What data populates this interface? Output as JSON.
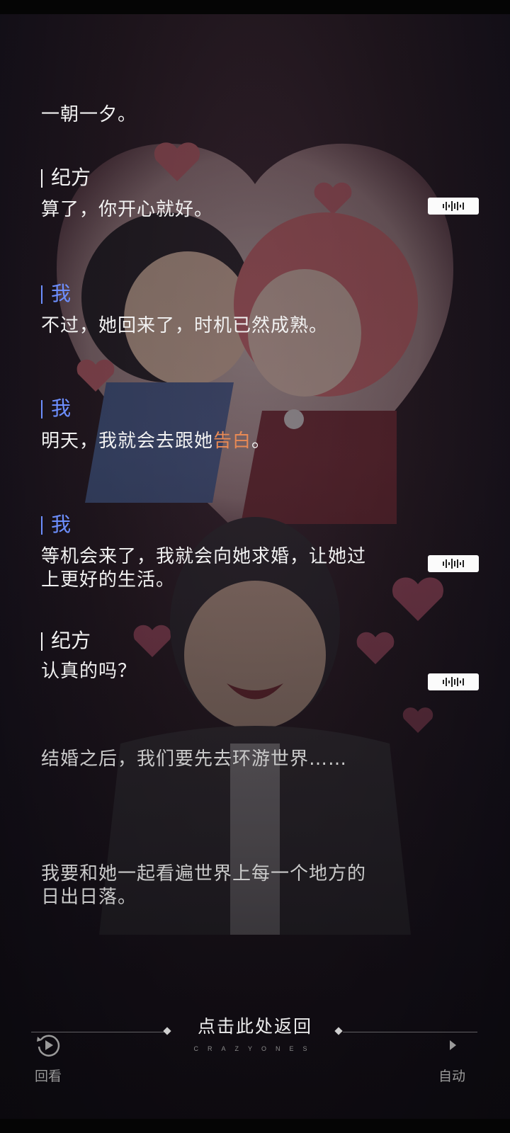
{
  "log": {
    "entries": [
      {
        "type": "line",
        "text": "一朝一夕。"
      },
      {
        "type": "speaker",
        "name": "纪方"
      },
      {
        "type": "line",
        "text": "算了，你开心就好。"
      },
      {
        "type": "speaker",
        "name": "我"
      },
      {
        "type": "line",
        "text": "不过，她回来了，时机已然成熟。"
      },
      {
        "type": "speaker",
        "name": "我"
      },
      {
        "type": "line",
        "text_before": "明天，我就会去跟她",
        "highlight": "告白",
        "text_after": "。"
      },
      {
        "type": "speaker",
        "name": "我"
      },
      {
        "type": "line",
        "text_line1": "等机会来了，我就会向她求婚，让她过",
        "text_line2": "上更好的生活。"
      },
      {
        "type": "speaker",
        "name": "纪方"
      },
      {
        "type": "line",
        "text": "认真的吗？"
      },
      {
        "type": "narration",
        "text": "结婚之后，我们要先去环游世界……"
      },
      {
        "type": "narration",
        "text_line1": "我要和她一起看遍世界上每一个地方的",
        "text_line2": "日出日落。"
      }
    ]
  },
  "footer": {
    "back_label": "点击此处返回",
    "brand": "CRAZYONES",
    "replay_label": "回看",
    "auto_label": "自动"
  },
  "colors": {
    "speaker_me": "#6d8fff",
    "speaker_other": "#f3f3f3",
    "highlight": "#e98a55",
    "text": "#f1f1f1",
    "narration": "#c9c9c9"
  }
}
